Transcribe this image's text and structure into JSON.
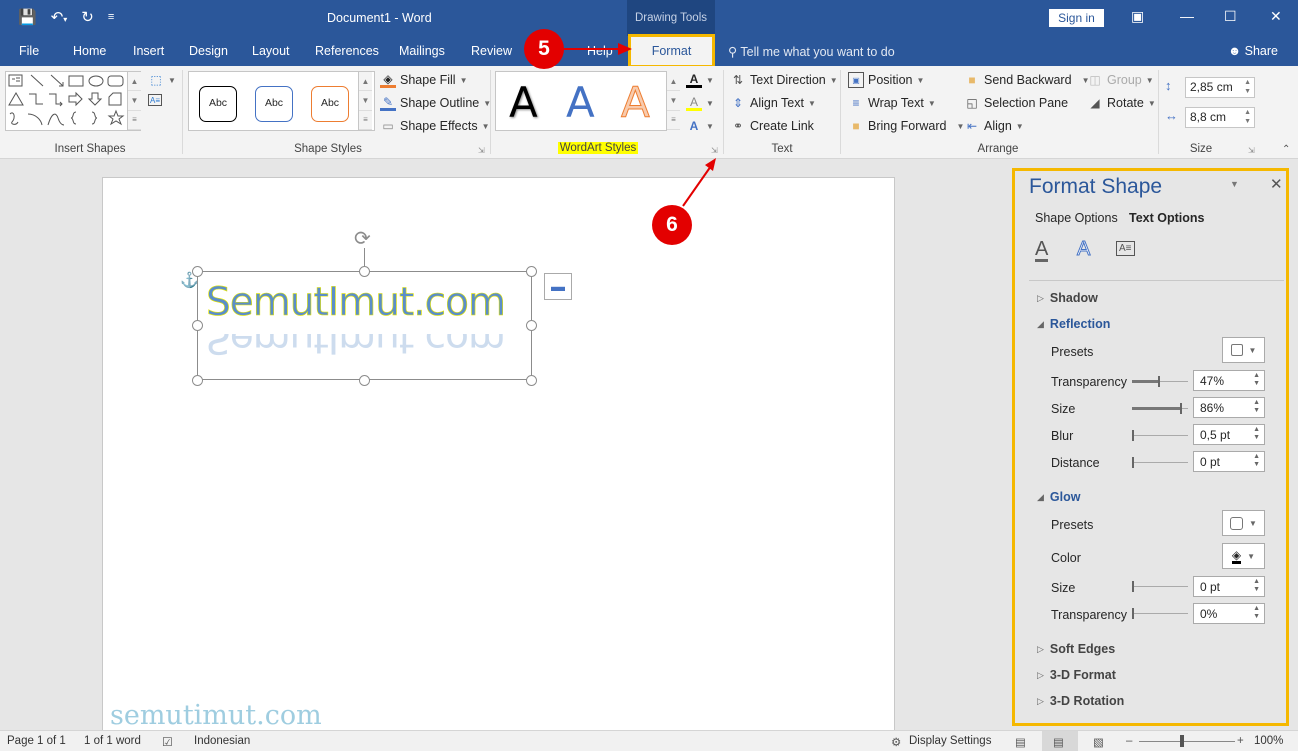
{
  "window": {
    "title": "Document1  -  Word",
    "context_tab_group": "Drawing Tools",
    "sign_in": "Sign in"
  },
  "quick_access": {
    "icons": [
      "save-icon",
      "undo-icon",
      "redo-icon",
      "customize-icon"
    ]
  },
  "tabs": [
    {
      "label": "File"
    },
    {
      "label": "Home"
    },
    {
      "label": "Insert"
    },
    {
      "label": "Design"
    },
    {
      "label": "Layout"
    },
    {
      "label": "References"
    },
    {
      "label": "Mailings"
    },
    {
      "label": "Review"
    },
    {
      "label": "Help"
    },
    {
      "label": "Format",
      "active": true
    }
  ],
  "tell_me": "Tell me what you want to do",
  "share": "Share",
  "ribbon": {
    "insert_shapes": {
      "label": "Insert Shapes"
    },
    "shape_styles": {
      "label": "Shape Styles",
      "presets": [
        "Abc",
        "Abc",
        "Abc"
      ],
      "preset_colors": [
        "#000000",
        "#4472c4",
        "#ed7d31"
      ],
      "fill": "Shape Fill",
      "outline": "Shape Outline",
      "effects": "Shape Effects"
    },
    "wordart_styles": {
      "label": "WordArt Styles",
      "samples": [
        "A",
        "A",
        "A"
      ],
      "highlight_color": "#ffff00"
    },
    "text": {
      "label": "Text",
      "direction": "Text Direction",
      "align": "Align Text",
      "link": "Create Link"
    },
    "arrange": {
      "label": "Arrange",
      "position": "Position",
      "wrap": "Wrap Text",
      "bring_forward": "Bring Forward",
      "send_backward": "Send Backward",
      "selection_pane": "Selection Pane",
      "align": "Align",
      "group": "Group",
      "rotate": "Rotate"
    },
    "size": {
      "label": "Size",
      "height": "2,85 cm",
      "width": "8,8 cm"
    }
  },
  "document": {
    "wordart_text": "SemutImut.com",
    "watermark": "semutimut.com"
  },
  "callouts": {
    "step5": "5",
    "step6": "6",
    "color": "#e30000"
  },
  "format_shape": {
    "title": "Format Shape",
    "tab_shape": "Shape Options",
    "tab_text": "Text Options",
    "sections": {
      "shadow": "Shadow",
      "reflection": "Reflection",
      "glow": "Glow",
      "soft_edges": "Soft Edges",
      "format_3d": "3-D Format",
      "rotation_3d": "3-D Rotation"
    },
    "reflection": {
      "presets_label": "Presets",
      "transparency_label": "Transparency",
      "transparency": "47%",
      "transparency_value": 0.47,
      "size_label": "Size",
      "size": "86%",
      "size_value": 0.86,
      "blur_label": "Blur",
      "blur": "0,5 pt",
      "distance_label": "Distance",
      "distance": "0 pt"
    },
    "glow": {
      "presets_label": "Presets",
      "color_label": "Color",
      "size_label": "Size",
      "size": "0 pt",
      "transparency_label": "Transparency",
      "transparency": "0%"
    },
    "accent_color": "#f5b800"
  },
  "status": {
    "page": "Page 1 of 1",
    "words": "1 of 1 word",
    "language": "Indonesian",
    "display_settings": "Display Settings",
    "zoom": "100%"
  }
}
